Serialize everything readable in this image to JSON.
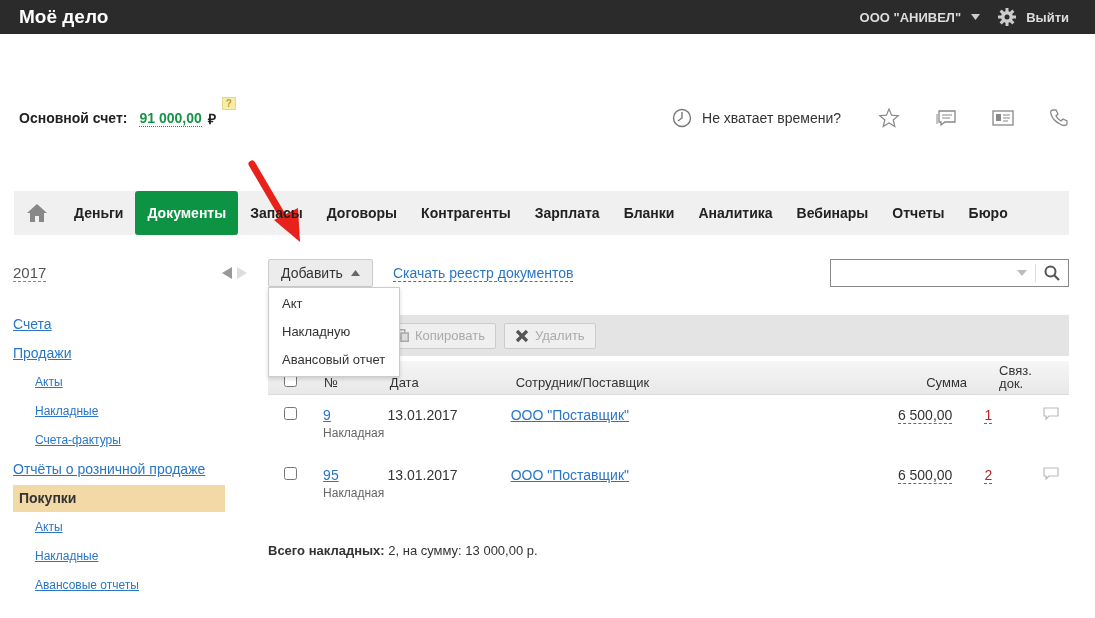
{
  "header": {
    "logo": "Моё дело",
    "company": "ООО \"АНИВЕЛ\"",
    "logout": "Выйти"
  },
  "balance": {
    "label": "Основной счет:",
    "amount": "91 000,00",
    "currency": "₽",
    "help": "?"
  },
  "promo": {
    "text": "Не хватает времени?"
  },
  "nav": [
    {
      "label": "Деньги",
      "selected": false
    },
    {
      "label": "Документы",
      "selected": true
    },
    {
      "label": "Запасы",
      "selected": false
    },
    {
      "label": "Договоры",
      "selected": false
    },
    {
      "label": "Контрагенты",
      "selected": false
    },
    {
      "label": "Зарплата",
      "selected": false
    },
    {
      "label": "Бланки",
      "selected": false
    },
    {
      "label": "Аналитика",
      "selected": false
    },
    {
      "label": "Вебинары",
      "selected": false
    },
    {
      "label": "Отчеты",
      "selected": false
    },
    {
      "label": "Бюро",
      "selected": false
    }
  ],
  "sidebar": {
    "year": "2017",
    "items": [
      {
        "label": "Счета",
        "selected": false
      },
      {
        "label": "Продажи",
        "selected": false,
        "children": [
          {
            "label": "Акты"
          },
          {
            "label": "Накладные"
          },
          {
            "label": "Счета-фактуры"
          }
        ]
      },
      {
        "label": "Отчёты о розничной продаже",
        "selected": false
      },
      {
        "label": "Покупки",
        "selected": true,
        "children": [
          {
            "label": "Акты"
          },
          {
            "label": "Накладные"
          },
          {
            "label": "Авансовые отчеты"
          }
        ]
      }
    ]
  },
  "add_button": {
    "label": "Добавить",
    "expanded": true,
    "menu": [
      "Акт",
      "Накладную",
      "Авансовый отчет"
    ]
  },
  "download_link": "Скачать реестр документов",
  "toolbar": [
    {
      "label": "Копировать",
      "kind": "copy",
      "disabled": true
    },
    {
      "label": "Удалить",
      "kind": "delete",
      "disabled": true
    }
  ],
  "table": {
    "select_all_checked": false,
    "columns": [
      "№",
      "Дата",
      "Сотрудник/Поставщик",
      "Сумма",
      "Связ. док."
    ],
    "rows": [
      {
        "checked": false,
        "number": "9",
        "type": "Накладная",
        "date": "13.01.2017",
        "counterparty": "ООО \"Поставщик\"",
        "sum": "6 500,00",
        "linked": "1"
      },
      {
        "checked": false,
        "number": "95",
        "type": "Накладная",
        "date": "13.01.2017",
        "counterparty": "ООО \"Поставщик\"",
        "sum": "6 500,00",
        "linked": "2"
      }
    ]
  },
  "total": "**Всего накладных:** 2, на сумму: 13 000,00 р."
}
